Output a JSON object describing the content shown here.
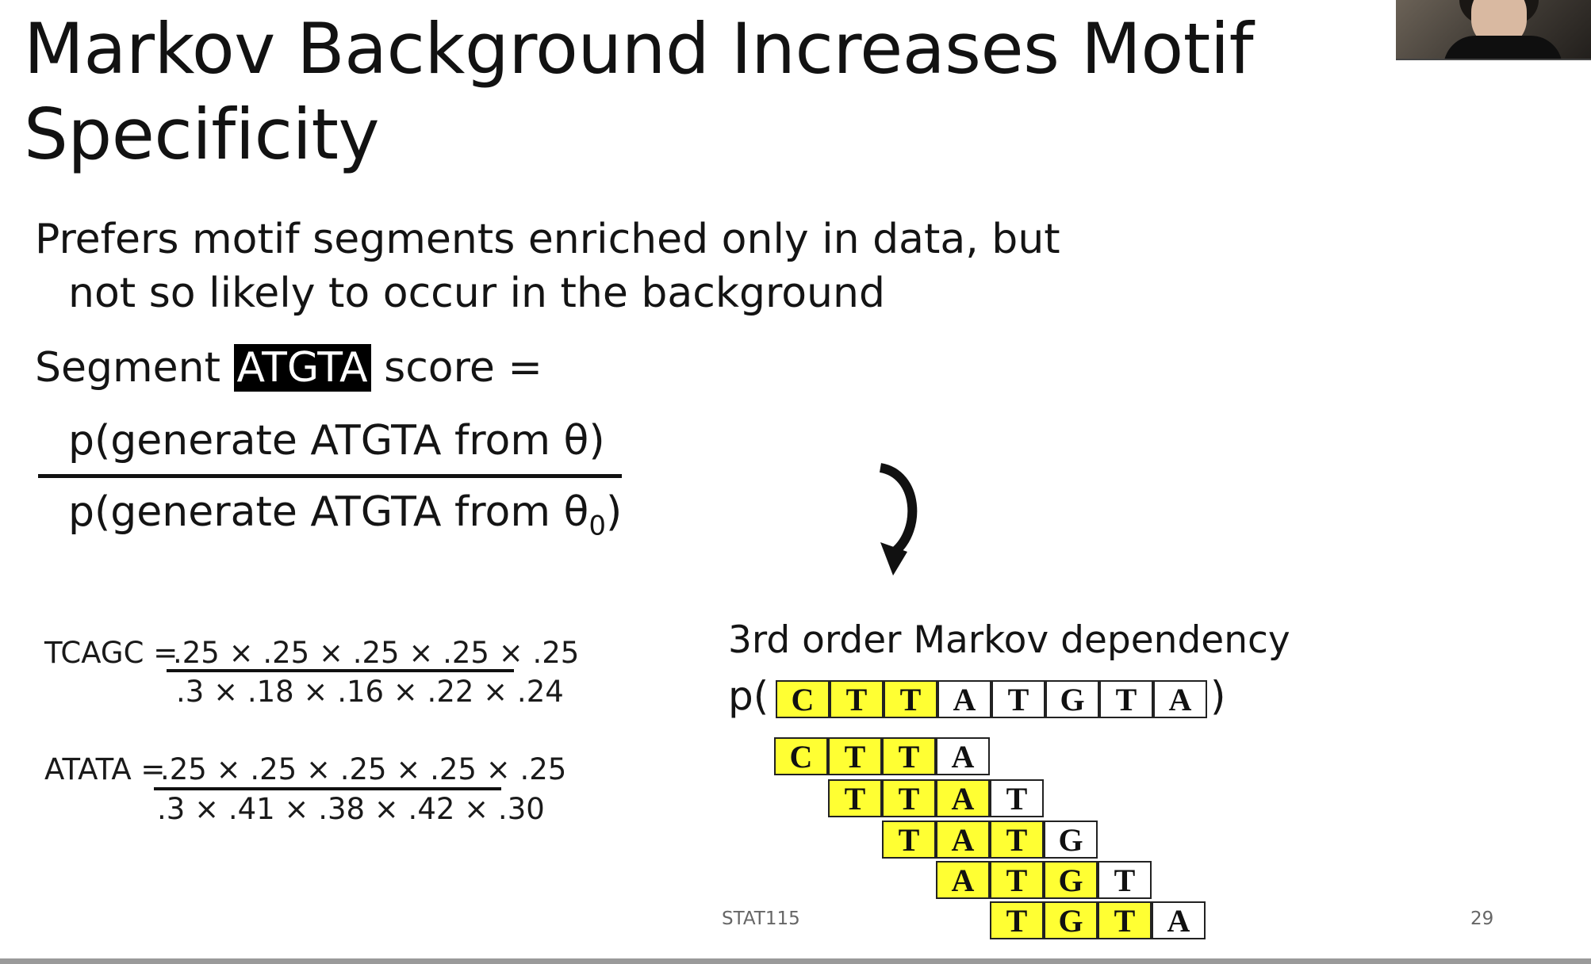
{
  "slide": {
    "title_line1": "Markov Background Increases Motif",
    "title_line2": "Specificity",
    "bullet_line1": "Prefers motif segments enriched only in data,  but",
    "bullet_line2": "not so likely to occur in the background",
    "segment_prefix": "Segment",
    "segment_highlight": "ATGTA",
    "segment_suffix": "score =",
    "numerator": "p(generate ATGTA from θ)",
    "denominator_main": "p(generate ATGTA from θ",
    "denominator_sub": "0",
    "denominator_close": ")",
    "examples": [
      {
        "label": "TCAGC =",
        "numerator": ".25 × .25 × .25 × .25 × .25",
        "denominator": ".3 × .18 × .16 × .22 × .24"
      },
      {
        "label": "ATATA =",
        "numerator": ".25 × .25 × .25 × .25 × .25",
        "denominator": ".3 × .41 × .38 × .42 × .30"
      }
    ],
    "markov_heading": "3rd order Markov dependency",
    "p_open": "p(",
    "p_close": ")",
    "sequence": [
      "C",
      "T",
      "T",
      "A",
      "T",
      "G",
      "T",
      "A"
    ],
    "sequence_highlight": [
      true,
      true,
      true,
      false,
      false,
      false,
      false,
      false
    ],
    "windows": [
      [
        "C",
        "T",
        "T",
        "A"
      ],
      [
        "T",
        "T",
        "A",
        "T"
      ],
      [
        "T",
        "A",
        "T",
        "G"
      ],
      [
        "A",
        "T",
        "G",
        "T"
      ],
      [
        "T",
        "G",
        "T",
        "A"
      ]
    ],
    "footer_course": "STAT115",
    "footer_page": "29"
  },
  "colors": {
    "highlight_box": "#ffff33",
    "text": "#111111",
    "footer": "#666666"
  },
  "icons": {
    "arrow": "curved-down-arrow-icon",
    "webcam": "webcam-thumbnail"
  }
}
